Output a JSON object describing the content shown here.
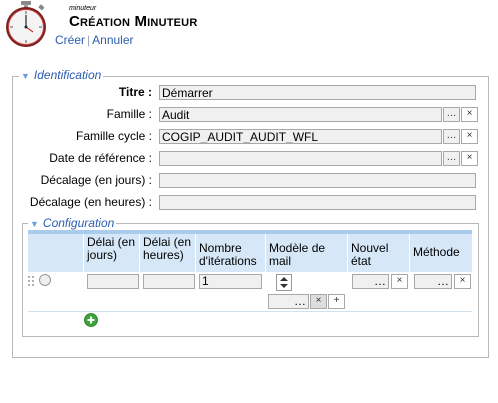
{
  "header": {
    "subtitle": "minuteur",
    "title": "Création Minuteur",
    "actions": {
      "create": "Créer",
      "cancel": "Annuler"
    }
  },
  "identification": {
    "legend": "Identification",
    "fields": {
      "titre": {
        "label": "Titre :",
        "value": "Démarrer"
      },
      "famille": {
        "label": "Famille :",
        "value": "Audit"
      },
      "famille_cycle": {
        "label": "Famille cycle :",
        "value": "COGIP_AUDIT_AUDIT_WFL"
      },
      "date_reference": {
        "label": "Date de référence :",
        "value": ""
      },
      "decalage_jours": {
        "label": "Décalage (en jours) :",
        "value": ""
      },
      "decalage_heures": {
        "label": "Décalage (en heures) :",
        "value": ""
      }
    },
    "ellipsis": "…",
    "clear": "×"
  },
  "configuration": {
    "legend": "Configuration",
    "columns": {
      "delai_jours": "Délai (en jours)",
      "delai_heures": "Délai (en heures)",
      "nb_iterations": "Nombre d'itérations",
      "modele_mail": "Modèle de mail",
      "nouvel_etat": "Nouvel état",
      "methode": "Méthode"
    },
    "row": {
      "delai_jours": "",
      "delai_heures": "",
      "nb_iterations": "1",
      "nouvel_etat": "",
      "methode": ""
    },
    "plus": "+",
    "ellipsis": "…",
    "clear": "×"
  },
  "colors": {
    "accent": "#2a5db0",
    "header_bg": "#d6e8f8",
    "header_top": "#a9cbec",
    "add_green": "#3aa33a"
  }
}
